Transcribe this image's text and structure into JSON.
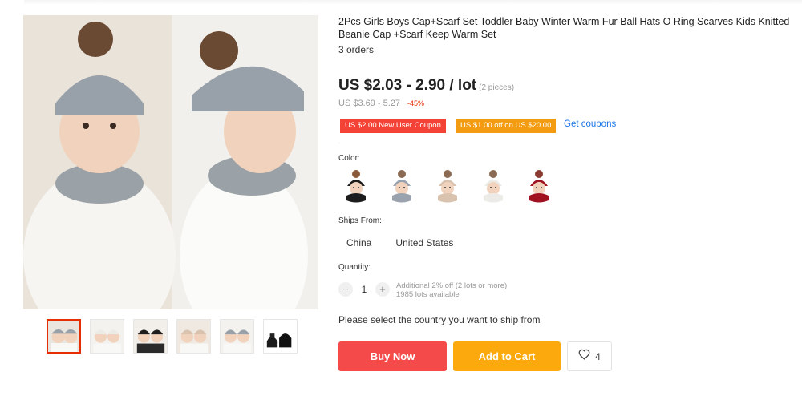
{
  "product": {
    "title": "2Pcs Girls Boys Cap+Scarf Set Toddler Baby Winter Warm Fur Ball Hats O Ring Scarves Kids Knitted Beanie Cap +Scarf Keep Warm Set",
    "orders": "3 orders"
  },
  "price": {
    "range": "US $2.03 - 2.90 / lot",
    "unit_note": "(2 pieces)",
    "original": "US $3.69 - 5.27",
    "discount": "-45%"
  },
  "coupons": {
    "new_user": "US $2.00 New User Coupon",
    "store": "US $1.00 off on US $20.00",
    "get_label": "Get coupons"
  },
  "options": {
    "color_label": "Color:",
    "colors": [
      {
        "name": "black",
        "hat": "#1d1d1d",
        "ball": "#8a5a3a"
      },
      {
        "name": "gray",
        "hat": "#9aa3ad",
        "ball": "#8a6a52"
      },
      {
        "name": "beige",
        "hat": "#d9c2ae",
        "ball": "#8a6a52"
      },
      {
        "name": "white",
        "hat": "#ecebe8",
        "ball": "#8a6a52"
      },
      {
        "name": "red",
        "hat": "#a01220",
        "ball": "#8a3a30"
      }
    ],
    "ships_from_label": "Ships From:",
    "ships_from": [
      "China",
      "United States"
    ],
    "quantity_label": "Quantity:",
    "quantity": "1",
    "qty_minus": "−",
    "qty_plus": "+",
    "qty_note_1": "Additional 2% off (2 lots or more)",
    "qty_note_2": "1985 lots available"
  },
  "ship_message": "Please select the country you want to ship from",
  "actions": {
    "buy_now": "Buy Now",
    "add_to_cart": "Add to Cart",
    "wishlist_count": "4"
  },
  "colors": {
    "accent_red": "#f44a4a",
    "accent_orange": "#fba90d",
    "link_blue": "#1a73e8"
  }
}
